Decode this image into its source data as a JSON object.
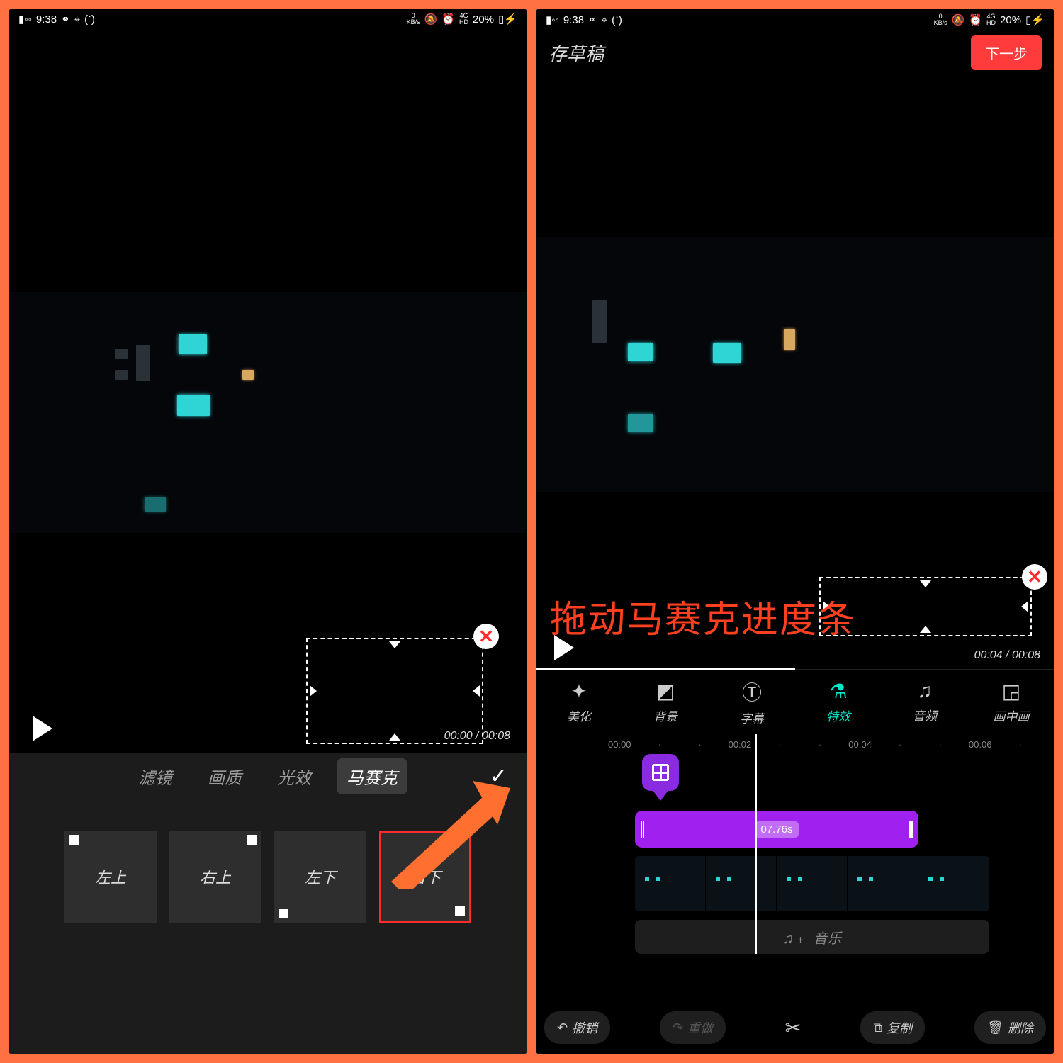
{
  "status": {
    "time": "9:38",
    "net_speed": "0",
    "net_unit": "KB/s",
    "sig": "4G",
    "hd": "HD",
    "battery": "20%"
  },
  "left": {
    "time_current": "00:00",
    "time_total": "00:08",
    "tabs": {
      "filter": "滤镜",
      "quality": "画质",
      "fx": "光效",
      "mosaic": "马赛克"
    },
    "positions": {
      "top_left": "左上",
      "top_right": "右上",
      "bottom_left": "左下",
      "bottom_right": "右下"
    }
  },
  "right": {
    "draft": "存草稿",
    "next": "下一步",
    "time_current": "00:04",
    "time_total": "00:08",
    "annotation": "拖动马赛克进度条",
    "tools": {
      "beautify": "美化",
      "background": "背景",
      "subtitle": "字幕",
      "effect": "特效",
      "audio": "音频",
      "pip": "画中画"
    },
    "ruler": {
      "t0": "00:00",
      "t1": "00:02",
      "t2": "00:04",
      "t3": "00:06"
    },
    "clip_duration": "07.76s",
    "music_label": "音乐",
    "actions": {
      "undo": "撤销",
      "redo": "重做",
      "copy": "复制",
      "delete": "删除"
    }
  }
}
